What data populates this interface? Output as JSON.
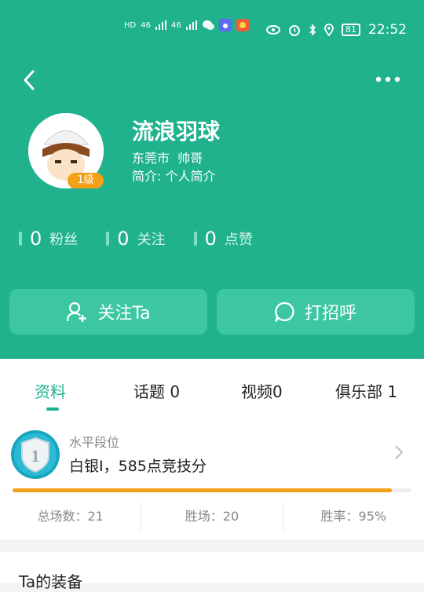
{
  "status_bar": {
    "left_indicators": [
      "HD",
      "46",
      "46"
    ],
    "battery": "81",
    "time": "22:52"
  },
  "profile": {
    "name": "流浪羽球",
    "location_tag": "东莞市  帅哥",
    "intro": "简介: 个人简介",
    "level": "1级"
  },
  "stats": [
    {
      "num": "0",
      "label": "粉丝"
    },
    {
      "num": "0",
      "label": "关注"
    },
    {
      "num": "0",
      "label": "点赞"
    }
  ],
  "buttons": {
    "follow": "关注Ta",
    "greet": "打招呼"
  },
  "tabs": [
    {
      "label": "资料"
    },
    {
      "label": "话题 0"
    },
    {
      "label": "视频0"
    },
    {
      "label": "俱乐部 1"
    }
  ],
  "rank": {
    "title": "水平段位",
    "value": "白银I，585点竞技分",
    "badge_number": "1",
    "progress_fraction": 0.95
  },
  "rank_stats": [
    {
      "label": "总场数：21"
    },
    {
      "label": "胜场：20"
    },
    {
      "label": "胜率：95%"
    }
  ],
  "equipment_title": "Ta的装备",
  "colors": {
    "brand": "#1fb28c",
    "accent": "#f5a019",
    "badge": "#18a5c0"
  }
}
